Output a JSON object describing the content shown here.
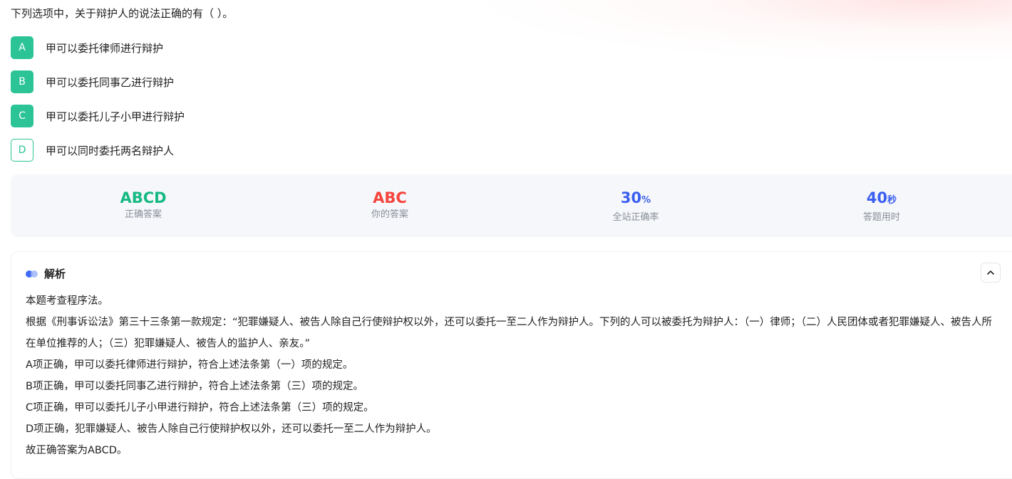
{
  "question": {
    "text": "下列选项中，关于辩护人的说法正确的有（ ）。"
  },
  "options": [
    {
      "letter": "A",
      "text": "甲可以委托律师进行辩护",
      "state": "correct"
    },
    {
      "letter": "B",
      "text": "甲可以委托同事乙进行辩护",
      "state": "correct"
    },
    {
      "letter": "C",
      "text": "甲可以委托儿子小甲进行辩护",
      "state": "correct"
    },
    {
      "letter": "D",
      "text": "甲可以同时委托两名辩护人",
      "state": "missed"
    }
  ],
  "stats": {
    "correct_answer": {
      "value": "ABCD",
      "label": "正确答案",
      "color": "#16b982"
    },
    "your_answer": {
      "value": "ABC",
      "label": "你的答案",
      "color": "#f5453d"
    },
    "accuracy": {
      "value": "30",
      "unit": "%",
      "label": "全站正确率",
      "color": "#3a5ff0"
    },
    "time": {
      "value": "40",
      "unit": "秒",
      "label": "答题用时",
      "color": "#3a5ff0"
    }
  },
  "analysis": {
    "title": "解析",
    "collapse_icon": "chevron-up-icon",
    "paragraphs": [
      "本题考查程序法。",
      "根据《刑事诉讼法》第三十三条第一款规定：“犯罪嫌疑人、被告人除自己行使辩护权以外，还可以委托一至二人作为辩护人。下列的人可以被委托为辩护人：（一）律师；（二）人民团体或者犯罪嫌疑人、被告人所在单位推荐的人；（三）犯罪嫌疑人、被告人的监护人、亲友。”",
      "A项正确，甲可以委托律师进行辩护，符合上述法条第（一）项的规定。",
      "B项正确，甲可以委托同事乙进行辩护，符合上述法条第（三）项的规定。",
      "C项正确，甲可以委托儿子小甲进行辩护，符合上述法条第（三）项的规定。",
      "D项正确，犯罪嫌疑人、被告人除自己行使辩护权以外，还可以委托一至二人作为辩护人。",
      "故正确答案为ABCD。"
    ]
  }
}
